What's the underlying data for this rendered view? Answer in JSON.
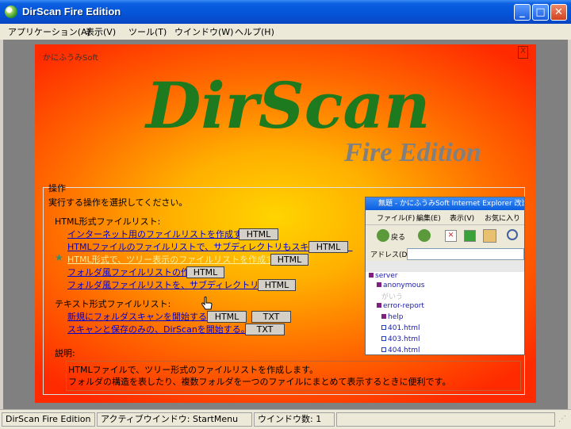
{
  "window": {
    "title": "DirScan Fire Edition",
    "minimize_label": "_",
    "maximize_label": "□",
    "close_label": "✕"
  },
  "menu": [
    {
      "label": "アプリケーション(A)"
    },
    {
      "label": "表示(V)"
    },
    {
      "label": "ツール(T)"
    },
    {
      "label": "ウインドウ(W)"
    },
    {
      "label": "ヘルプ(H)"
    }
  ],
  "panel": {
    "brand": "かにふうみSoft",
    "close_label": "X",
    "logo": "DirScan",
    "subtitle": "Fire Edition",
    "colors": {
      "logo": "#1e7a1e",
      "subtitle": "#808080",
      "link": "#0000d0",
      "highlight_link": "#f5f0a0"
    }
  },
  "operations": {
    "group_label": "操作",
    "instruction": "実行する操作を選択してください。",
    "html_section": "HTML形式ファイルリスト:",
    "html_items": [
      {
        "label": "インターネット用のファイルリストを作成する。",
        "buttons": [
          "HTML"
        ]
      },
      {
        "label": "HTMLファイルのファイルリストで、サブディレクトリもスキャンする。",
        "buttons": [
          "HTML"
        ]
      },
      {
        "label": "HTML形式で、ツリー表示のファイルリストを作成する。",
        "buttons": [
          "HTML"
        ],
        "selected": true
      },
      {
        "label": "フォルダ風ファイルリストの作成",
        "buttons": [
          "HTML"
        ]
      },
      {
        "label": "フォルダ風ファイルリストを、サブディレクトリも作成",
        "buttons": [
          "HTML"
        ]
      }
    ],
    "text_section": "テキスト形式ファイルリスト:",
    "text_items": [
      {
        "label": "新規にフォルダスキャンを開始する。",
        "buttons": [
          "HTML",
          "TXT"
        ]
      },
      {
        "label": "スキャンと保存のみの、DirScanを開始する。",
        "buttons": [
          "TXT"
        ]
      }
    ],
    "description_label": "説明:",
    "description_lines": [
      "HTMLファイルで、ツリー形式のファイルリストを作成します。",
      "フォルダの構造を表したり、複数フォルダを一つのファイルにまとめて表示するときに便利です。"
    ]
  },
  "preview": {
    "title": "無題 - かにふうみSoft Internet Explorer 改造版",
    "menu": [
      "ファイル(F)",
      "編集(E)",
      "表示(V)",
      "お気に入り"
    ],
    "back_label": "戻る",
    "address_label": "アドレス(D)",
    "tree": [
      "server",
      "anonymous",
      "がいう",
      "error-report",
      "help",
      "401.html",
      "403.html",
      "404.html"
    ]
  },
  "status": {
    "app": "DirScan Fire Edition",
    "active_window": "アクティブウインドウ: StartMenu",
    "window_count": "ウインドウ数: 1"
  }
}
